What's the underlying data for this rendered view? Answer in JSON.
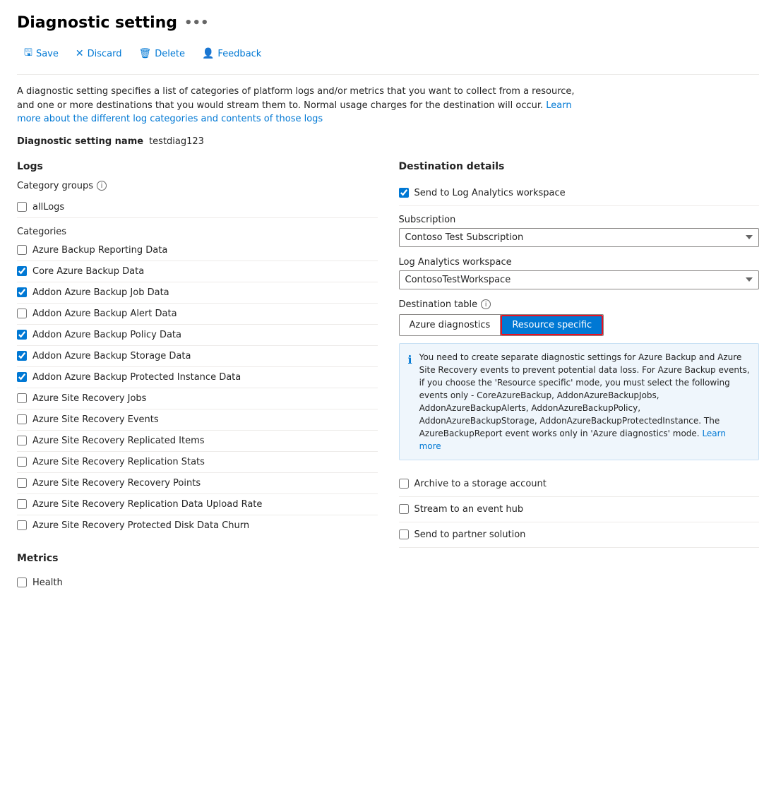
{
  "page": {
    "title": "Diagnostic setting",
    "more_icon": "•••"
  },
  "toolbar": {
    "save_label": "Save",
    "discard_label": "Discard",
    "delete_label": "Delete",
    "feedback_label": "Feedback"
  },
  "description": {
    "text1": "A diagnostic setting specifies a list of categories of platform logs and/or metrics that you want to collect from a resource, and one or more destinations that you would stream them to. Normal usage charges for the destination will occur.",
    "link_text": "Learn more about the different log categories and contents of those logs",
    "link_url": "#"
  },
  "setting_name": {
    "label": "Diagnostic setting name",
    "value": "testdiag123"
  },
  "logs": {
    "section_title": "Logs",
    "category_groups": {
      "label": "Category groups",
      "items": [
        {
          "id": "allLogs",
          "label": "allLogs",
          "checked": false
        }
      ]
    },
    "categories_title": "Categories",
    "categories": [
      {
        "id": "cat1",
        "label": "Azure Backup Reporting Data",
        "checked": false
      },
      {
        "id": "cat2",
        "label": "Core Azure Backup Data",
        "checked": true
      },
      {
        "id": "cat3",
        "label": "Addon Azure Backup Job Data",
        "checked": true
      },
      {
        "id": "cat4",
        "label": "Addon Azure Backup Alert Data",
        "checked": false
      },
      {
        "id": "cat5",
        "label": "Addon Azure Backup Policy Data",
        "checked": true
      },
      {
        "id": "cat6",
        "label": "Addon Azure Backup Storage Data",
        "checked": true
      },
      {
        "id": "cat7",
        "label": "Addon Azure Backup Protected Instance Data",
        "checked": true
      },
      {
        "id": "cat8",
        "label": "Azure Site Recovery Jobs",
        "checked": false
      },
      {
        "id": "cat9",
        "label": "Azure Site Recovery Events",
        "checked": false
      },
      {
        "id": "cat10",
        "label": "Azure Site Recovery Replicated Items",
        "checked": false
      },
      {
        "id": "cat11",
        "label": "Azure Site Recovery Replication Stats",
        "checked": false
      },
      {
        "id": "cat12",
        "label": "Azure Site Recovery Recovery Points",
        "checked": false
      },
      {
        "id": "cat13",
        "label": "Azure Site Recovery Replication Data Upload Rate",
        "checked": false
      },
      {
        "id": "cat14",
        "label": "Azure Site Recovery Protected Disk Data Churn",
        "checked": false
      }
    ]
  },
  "metrics": {
    "section_title": "Metrics",
    "items": [
      {
        "id": "health",
        "label": "Health",
        "checked": false
      }
    ]
  },
  "destination": {
    "section_title": "Destination details",
    "log_analytics": {
      "label": "Send to Log Analytics workspace",
      "checked": true
    },
    "subscription": {
      "label": "Subscription",
      "value": "Contoso Test Subscription",
      "options": [
        "Contoso Test Subscription"
      ]
    },
    "workspace": {
      "label": "Log Analytics workspace",
      "value": "ContosoTestWorkspace",
      "options": [
        "ContosoTestWorkspace"
      ]
    },
    "destination_table": {
      "label": "Destination table",
      "azure_diagnostics_label": "Azure diagnostics",
      "resource_specific_label": "Resource specific",
      "active": "resource_specific"
    },
    "info_box": {
      "text": "You need to create separate diagnostic settings for Azure Backup and Azure Site Recovery events to prevent potential data loss. For Azure Backup events, if you choose the 'Resource specific' mode, you must select the following events only - CoreAzureBackup, AddonAzureBackupJobs, AddonAzureBackupAlerts, AddonAzureBackupPolicy, AddonAzureBackupStorage, AddonAzureBackupProtectedInstance. The AzureBackupReport event works only in 'Azure diagnostics' mode.",
      "learn_more_text": "Learn more",
      "learn_more_url": "#"
    },
    "archive": {
      "label": "Archive to a storage account",
      "checked": false
    },
    "stream": {
      "label": "Stream to an event hub",
      "checked": false
    },
    "partner": {
      "label": "Send to partner solution",
      "checked": false
    }
  }
}
